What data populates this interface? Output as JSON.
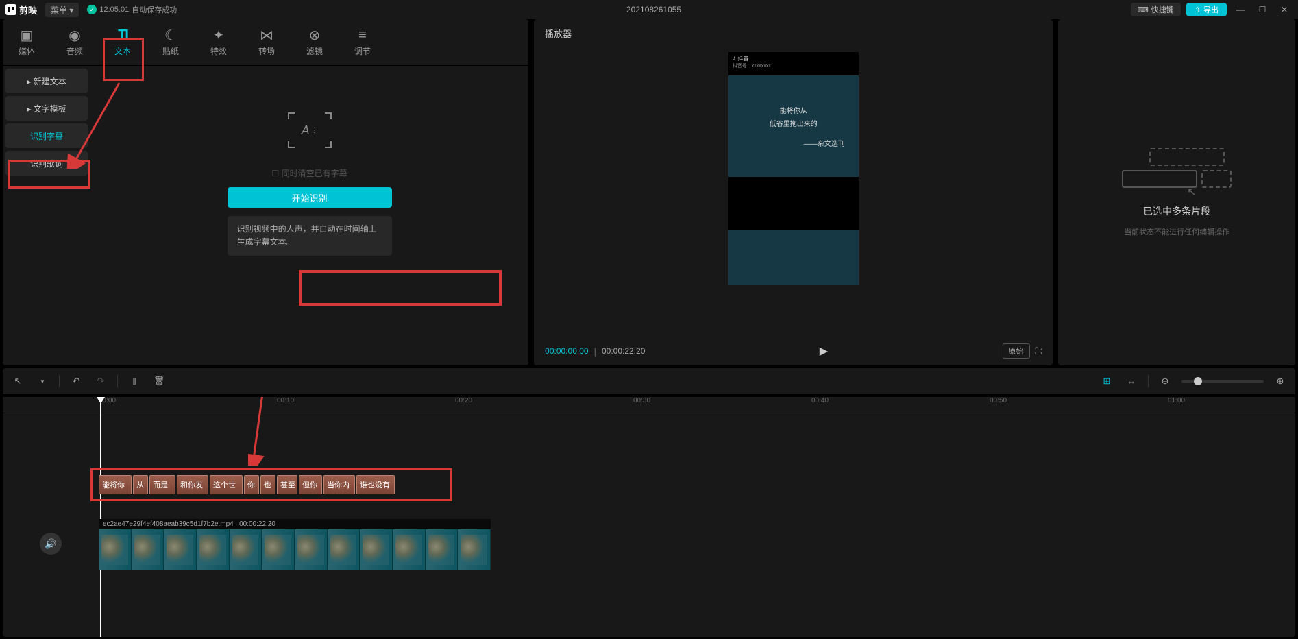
{
  "topbar": {
    "app_name": "剪映",
    "menu_label": "菜单 ▾",
    "autosave_time": "12:05:01",
    "autosave_text": "自动保存成功",
    "project_title": "202108261055",
    "shortcut_label": "快捷键",
    "export_label": "导出"
  },
  "tabs": [
    {
      "label": "媒体",
      "icon": "▶"
    },
    {
      "label": "音频",
      "icon": "◉"
    },
    {
      "label": "文本",
      "icon": "TI",
      "active": true
    },
    {
      "label": "贴纸",
      "icon": "☾"
    },
    {
      "label": "特效",
      "icon": "✦"
    },
    {
      "label": "转场",
      "icon": "⋈"
    },
    {
      "label": "滤镜",
      "icon": "⊗"
    },
    {
      "label": "调节",
      "icon": "⚙"
    }
  ],
  "sidebar": [
    {
      "label": "▸ 新建文本"
    },
    {
      "label": "▸ 文字模板"
    },
    {
      "label": "识别字幕",
      "active": true
    },
    {
      "label": "识别歌词"
    }
  ],
  "recognize": {
    "clear_text": "☐ 同时清空已有字幕",
    "button_label": "开始识别",
    "description": "识别视频中的人声，并自动在时间轴上生成字幕文本。"
  },
  "player": {
    "header": "播放器",
    "douyin_label": "抖音",
    "douyin_id": "抖音号：xxxxxxxx",
    "line1": "能将你从",
    "line2": "低谷里拖出来的",
    "line3": "——杂文选刊",
    "time_current": "00:00:00:00",
    "time_total": "00:00:22:20",
    "original_label": "原始"
  },
  "right_panel": {
    "title": "已选中多条片段",
    "subtitle": "当前状态不能进行任何编辑操作"
  },
  "timeline": {
    "ticks": [
      "00:00",
      "00:10",
      "00:20",
      "00:30",
      "00:40",
      "00:50",
      "01:00"
    ],
    "subtitles": [
      "能将你",
      "从",
      "而是",
      "和你发",
      "这个世",
      "你",
      "也",
      "甚至",
      "但你",
      "当你内",
      "谁也没有"
    ],
    "video_filename": "ec2ae47e29f4ef408aeab39c5d1f7b2e.mp4",
    "video_duration": "00:00:22:20"
  }
}
